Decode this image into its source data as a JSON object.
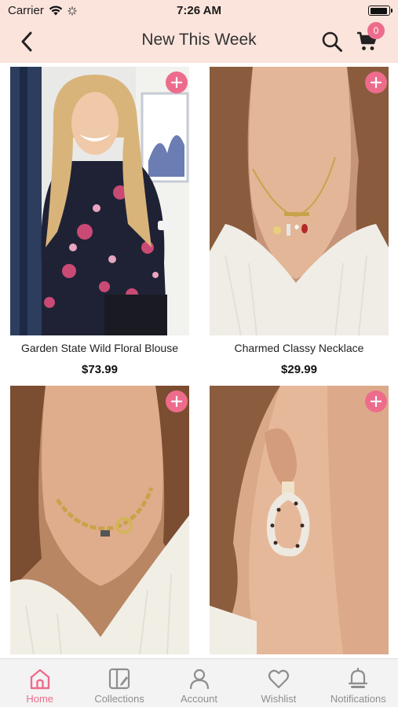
{
  "status_bar": {
    "carrier": "Carrier",
    "time": "7:26 AM"
  },
  "nav": {
    "title": "New This Week",
    "cart_count": "0",
    "icons": [
      "chevron-left-icon",
      "search-icon",
      "cart-icon"
    ]
  },
  "products": [
    {
      "name": "Garden State Wild Floral Blouse",
      "price": "$73.99"
    },
    {
      "name": "Charmed Classy Necklace",
      "price": "$29.99"
    },
    {
      "name": "",
      "price": ""
    },
    {
      "name": "",
      "price": ""
    }
  ],
  "tabs": [
    {
      "label": "Home",
      "icon": "home-icon",
      "active": true
    },
    {
      "label": "Collections",
      "icon": "collections-icon",
      "active": false
    },
    {
      "label": "Account",
      "icon": "person-icon",
      "active": false
    },
    {
      "label": "Wishlist",
      "icon": "heart-icon",
      "active": false
    },
    {
      "label": "Notifications",
      "icon": "bell-icon",
      "active": false
    }
  ],
  "colors": {
    "accent": "#ed6c8c",
    "header_bg": "#fbe4dc",
    "tabbar_bg": "#f3f3f3"
  }
}
